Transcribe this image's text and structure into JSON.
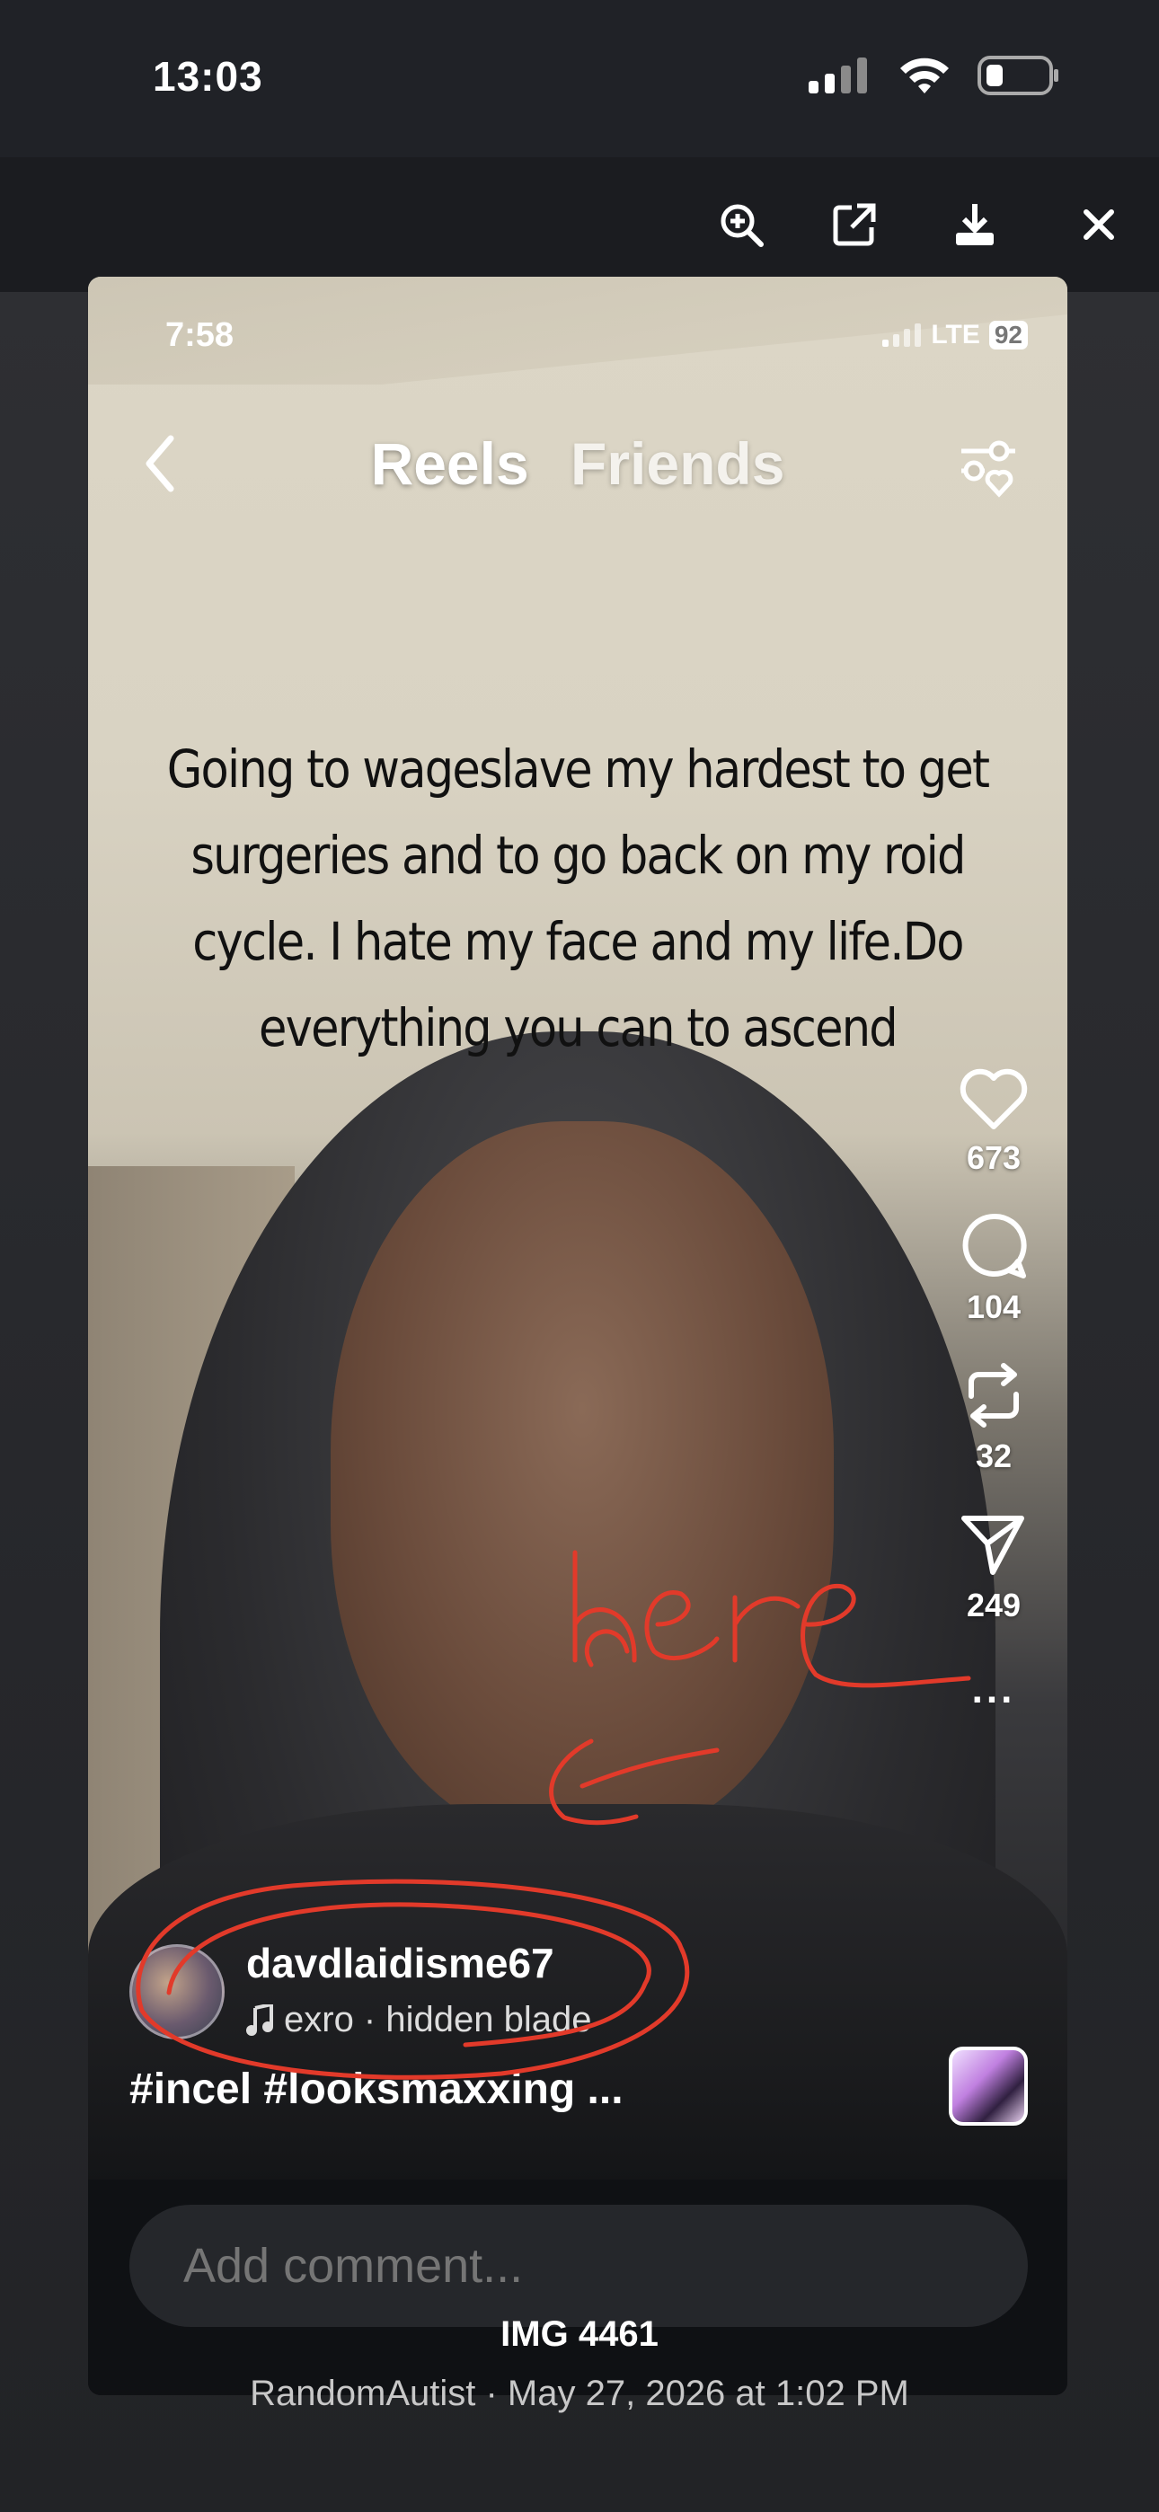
{
  "status_bar": {
    "time": "13:03",
    "icons": [
      "signal-icon",
      "wifi-icon",
      "battery-icon"
    ]
  },
  "toolbar": {
    "icons": [
      "zoom-in-icon",
      "open-external-icon",
      "download-icon",
      "close-icon"
    ]
  },
  "reel": {
    "time": "7:58",
    "network": "LTE",
    "battery": "92",
    "tabs": [
      "Reels",
      "Friends"
    ],
    "caption": [
      "Going to wageslave my hardest to get",
      "surgeries and to go back on my roid",
      "cycle. I hate my face and my life.Do",
      "everything you can to ascend"
    ],
    "likes": "673",
    "comments": "104",
    "reposts": "32",
    "shares": "249",
    "more": "...",
    "username": "davdlaidisme67",
    "music": "exro · hidden blade",
    "hashtags": "#incel #looksmaxxing ...",
    "annotation_text": "here",
    "comment_placeholder": "Add comment..."
  },
  "footer": {
    "title": "IMG 4461",
    "meta": "RandomAutist · May 27, 2026 at 1:02 PM"
  },
  "colors": {
    "annotation": "#e23a2a",
    "background": "#2a2b2f",
    "card": "#0f1114"
  }
}
